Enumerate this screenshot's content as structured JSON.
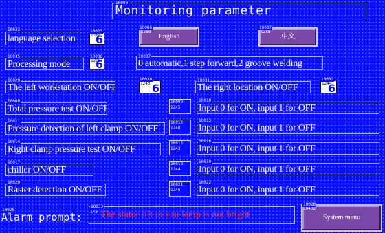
{
  "title": {
    "tag": "10000",
    "text": "Monitoring parameter"
  },
  "language": {
    "tag": "10023",
    "label": "language selection",
    "indicator": {
      "tag": "1288",
      "value": "6"
    },
    "btn_en": {
      "tag": "10006",
      "sub": "1288",
      "label": "English"
    },
    "btn_cn": {
      "tag": "10007",
      "sub": "1288",
      "label": "中文"
    }
  },
  "processing": {
    "tag": "10035",
    "label": "Processing mode",
    "indicator": {
      "tag": "10036",
      "sub": "1200",
      "value": "6"
    },
    "text_tag": "10037",
    "text": "0 automatic,1 step forward,2 groove welding"
  },
  "workstation": {
    "left": {
      "tag": "10029",
      "label": "The left workstation ON/OFF",
      "ind_tag": "10030",
      "ind_sub": "1245",
      "value": "6"
    },
    "right": {
      "tag": "10031",
      "label": "The right location ON/OFF",
      "ind_tag": "10032",
      "ind_sub": "1244",
      "value": "6"
    }
  },
  "rows": [
    {
      "tag": "10008",
      "label": "Total pressure test ON/OFF",
      "lamp_tag": "10009",
      "lamp_sub": "1245",
      "hint_tag": "10010",
      "hint": "Input 0 for ON, input 1 for OFF"
    },
    {
      "tag": "10011",
      "label": "Pressure detection of left clamp ON/OFF",
      "lamp_tag": "10012",
      "lamp_sub": "1240",
      "hint_tag": "10013",
      "hint": "Input 0 for ON, input 1 for OFF"
    },
    {
      "tag": "10014",
      "label": "Right clamp pressure test ON/OFF",
      "lamp_tag": "10015",
      "lamp_sub": "1243",
      "hint_tag": "10016",
      "hint": "Input 0 for ON, input 1 for OFF"
    },
    {
      "tag": "10017",
      "label": "chiller ON/OFF",
      "lamp_tag": "10018",
      "lamp_sub": "1244",
      "hint_tag": "10019",
      "hint": "Input 0 for ON, input 1 for OFF"
    },
    {
      "tag": "10020",
      "label": "Raster detection ON/OFF",
      "lamp_tag": "10021",
      "lamp_sub": "1246",
      "hint_tag": "10022",
      "hint": "Input 0 for ON, input 1 for OFF"
    }
  ],
  "alarm": {
    "tag": "10028",
    "label": "Alarm prompt:",
    "msg_tag": "10033",
    "msg_sub": "1/3",
    "message": "The stator lift in situ lamp is not bright"
  },
  "system_btn": {
    "tag": "10026",
    "sub": "10402",
    "label": "System menu"
  }
}
